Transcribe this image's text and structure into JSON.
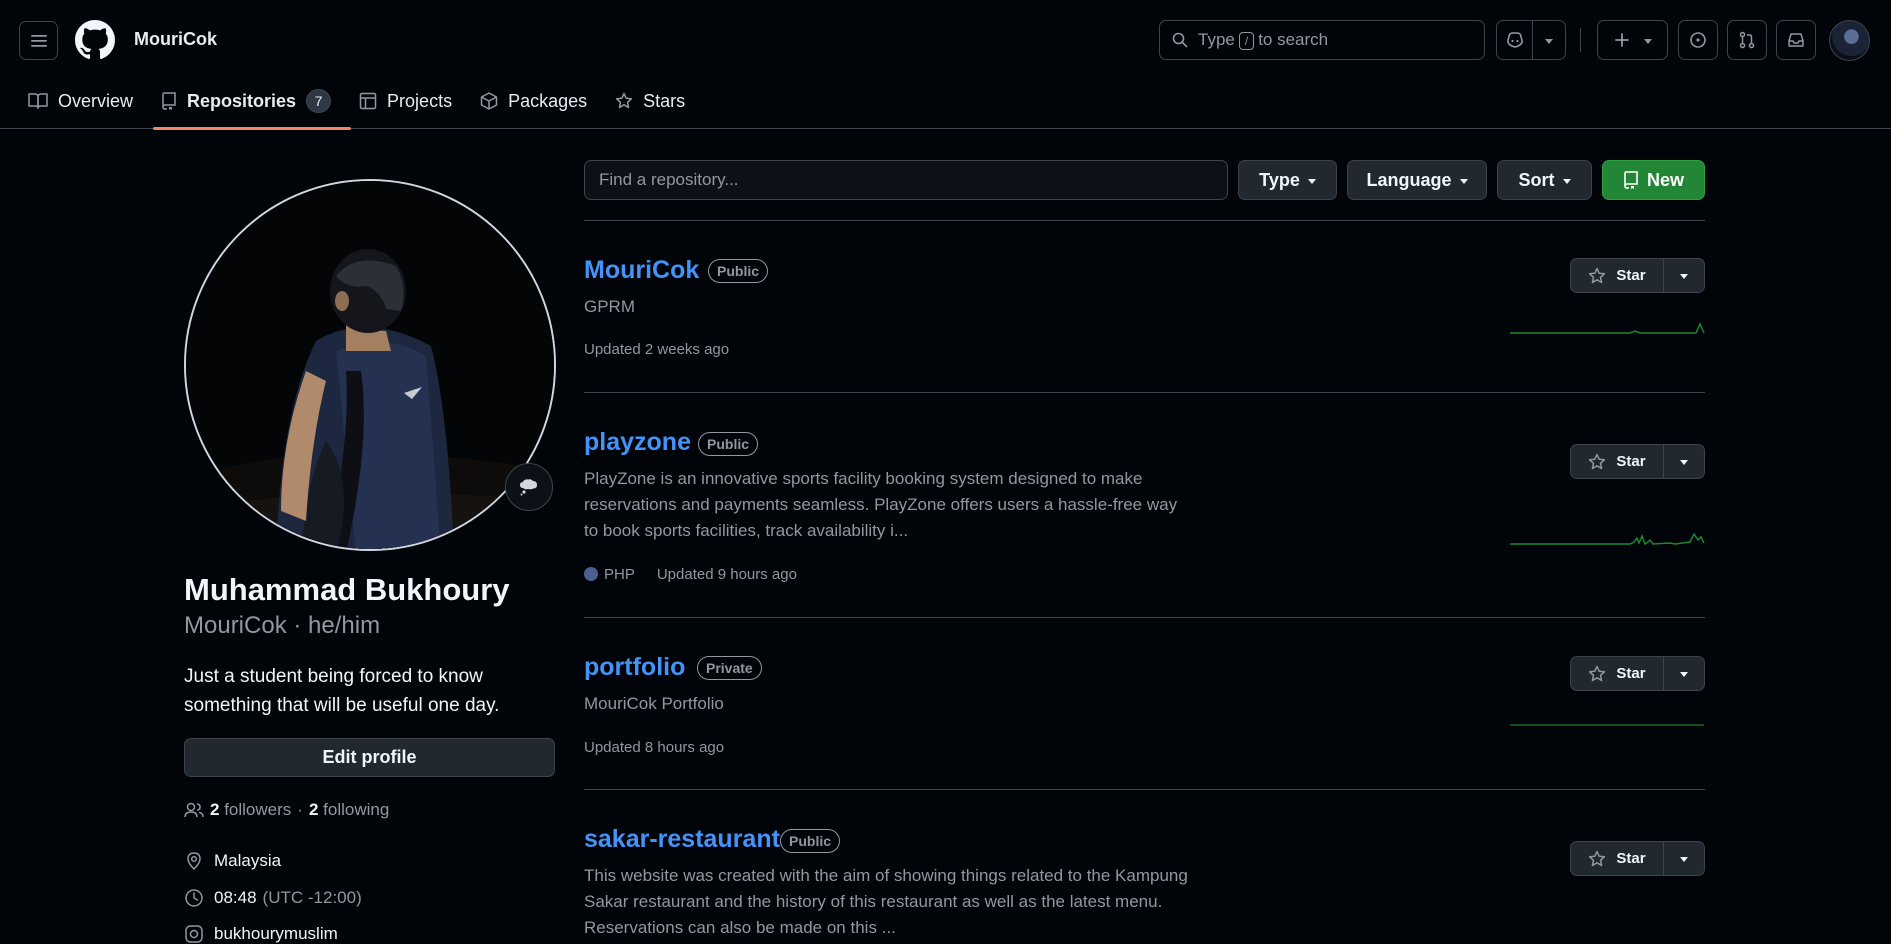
{
  "header": {
    "username": "MouriCok",
    "search": {
      "before": "Type",
      "key": "/",
      "after": "to search"
    }
  },
  "tabs": [
    {
      "label": "Overview"
    },
    {
      "label": "Repositories",
      "count": "7"
    },
    {
      "label": "Projects"
    },
    {
      "label": "Packages"
    },
    {
      "label": "Stars"
    }
  ],
  "profile": {
    "full_name": "Muhammad Bukhoury",
    "handle": "MouriCok · he/him",
    "bio": "Just a student being forced to know something that will be useful one day.",
    "edit_label": "Edit profile",
    "followers_count": "2",
    "followers_label": "followers",
    "following_count": "2",
    "following_label": "following",
    "location": "Malaysia",
    "time": "08:48",
    "timezone": "(UTC -12:00)",
    "social": "bukhourymuslim"
  },
  "filters": {
    "find_placeholder": "Find a repository...",
    "type_label": "Type",
    "language_label": "Language",
    "sort_label": "Sort",
    "new_label": "New"
  },
  "repos": [
    {
      "name": "MouriCok",
      "visibility": "Public",
      "description": "GPRM",
      "updated": "Updated 2 weeks ago",
      "star_label": "Star"
    },
    {
      "name": "playzone",
      "visibility": "Public",
      "description": "PlayZone is an innovative sports facility booking system designed to make reservations and payments seamless. PlayZone offers users a hassle-free way to book sports facilities, track availability i...",
      "language": "PHP",
      "updated": "Updated 9 hours ago",
      "star_label": "Star"
    },
    {
      "name": "portfolio",
      "visibility": "Private",
      "description": "MouriCok Portfolio",
      "updated": "Updated 8 hours ago",
      "star_label": "Star"
    },
    {
      "name": "sakar-restaurant",
      "visibility": "Public",
      "description": "This website was created with the aim of showing things related to the Kampung Sakar restaurant and the history of this restaurant as well as the latest menu. Reservations can also be made on this ...",
      "star_label": "Star"
    }
  ],
  "colors": {
    "background": "#010409",
    "link": "#4493f8",
    "new_button": "#238636",
    "tab_underline": "#f78166",
    "php": "#4F5D95",
    "sparkline": "#26a641"
  },
  "icons": [
    "hamburger-icon",
    "github-logo-icon",
    "search-icon",
    "copilot-icon",
    "plus-icon",
    "issues-icon",
    "pull-request-icon",
    "inbox-icon",
    "book-icon",
    "repo-icon",
    "table-icon",
    "package-icon",
    "star-icon",
    "people-icon",
    "location-icon",
    "clock-icon",
    "instagram-icon",
    "thought-bubble-icon"
  ]
}
